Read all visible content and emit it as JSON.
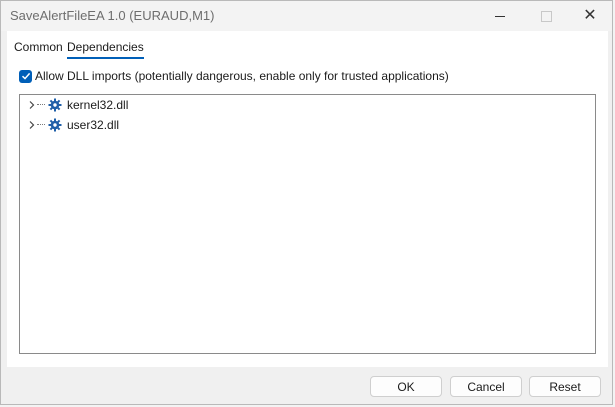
{
  "window": {
    "title": "SaveAlertFileEA 1.0 (EURAUD,M1)"
  },
  "tabs": [
    {
      "label": "Common",
      "selected": false
    },
    {
      "label": "Dependencies",
      "selected": true
    }
  ],
  "options": {
    "allow_dll": {
      "label": "Allow DLL imports (potentially dangerous, enable only for trusted applications)",
      "checked": true
    }
  },
  "tree": {
    "items": [
      {
        "label": "kernel32.dll",
        "icon": "gear-icon"
      },
      {
        "label": "user32.dll",
        "icon": "gear-icon"
      }
    ]
  },
  "buttons": {
    "ok": "OK",
    "cancel": "Cancel",
    "reset": "Reset"
  },
  "colors": {
    "accent": "#005fb8"
  }
}
